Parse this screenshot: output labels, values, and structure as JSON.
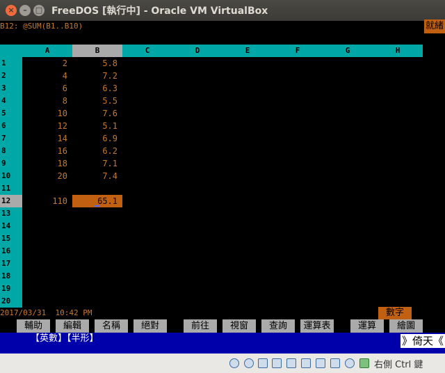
{
  "window": {
    "title": "FreeDOS [執行中] - Oracle VM VirtualBox",
    "close_icon": "×",
    "minimize_icon": "–",
    "maximize_icon": "□"
  },
  "sheet": {
    "cell_ref": "B12: @SUM(B1..B10)",
    "mode": "就緒",
    "columns": [
      "A",
      "B",
      "C",
      "D",
      "E",
      "F",
      "G",
      "H"
    ],
    "selected_column": "B",
    "rows": [
      "1",
      "2",
      "3",
      "4",
      "5",
      "6",
      "7",
      "8",
      "9",
      "10",
      "11",
      "12",
      "13",
      "14",
      "15",
      "16",
      "17",
      "18",
      "19",
      "20"
    ],
    "selected_row": "12",
    "col_a": [
      "2",
      "4",
      "6",
      "8",
      "10",
      "12",
      "14",
      "16",
      "18",
      "20",
      "",
      "110",
      "",
      "",
      "",
      "",
      "",
      "",
      "",
      ""
    ],
    "col_b": [
      "5.8",
      "7.2",
      "6.3",
      "5.5",
      "7.6",
      "5.1",
      "6.9",
      "6.2",
      "7.1",
      "7.4",
      "",
      "65.1",
      "",
      "",
      "",
      "",
      "",
      "",
      "",
      ""
    ],
    "status_datetime": "2017/03/31  10:42 PM",
    "numlock": "數字",
    "function_keys": [
      "輔助",
      "編輯",
      "名稱",
      "絕對",
      "",
      "前往",
      "視窗",
      "查詢",
      "運算表",
      "",
      "運算",
      "繪圖"
    ]
  },
  "ime": {
    "left": "【英數】【半形】",
    "right": "》倚天《"
  },
  "vbox": {
    "host_key": "右側 Ctrl 鍵"
  }
}
